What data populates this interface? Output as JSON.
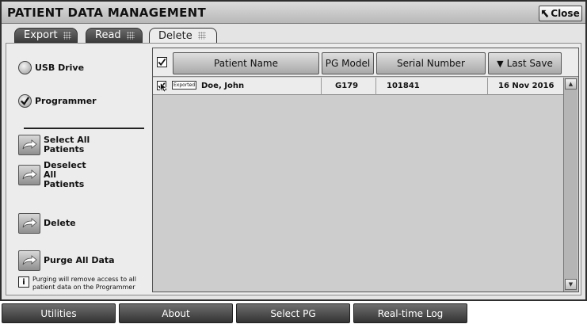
{
  "window": {
    "title": "PATIENT DATA MANAGEMENT",
    "close_label": "Close"
  },
  "tabs": [
    {
      "label": "Export",
      "active": false
    },
    {
      "label": "Read",
      "active": false
    },
    {
      "label": "Delete",
      "active": true
    }
  ],
  "source": {
    "options": [
      {
        "label": "USB Drive",
        "selected": false
      },
      {
        "label": "Programmer",
        "selected": true
      }
    ]
  },
  "actions": {
    "select_all": "Select All Patients",
    "deselect_all": "Deselect All Patients",
    "delete": "Delete",
    "purge_all": "Purge All Data"
  },
  "info": {
    "text": "Purging will remove access to all patient data on the Programmer"
  },
  "table": {
    "columns": [
      "Patient Name",
      "PG Model",
      "Serial Number",
      "Last Save"
    ],
    "sort_column": "Last Save",
    "sort_icon": "sort-descending-icon",
    "rows": [
      {
        "checked": true,
        "badge": "Exported",
        "patient_name": "Doe, John",
        "pg_model": "G179",
        "serial_number": "101841",
        "last_save": "16 Nov 2016"
      }
    ]
  },
  "bottom_nav": [
    "Utilities",
    "About",
    "Select PG",
    "Real-time Log"
  ],
  "colors": {
    "window_bg": "#e4e4e4",
    "table_bg": "#cdcdcd",
    "button_dark": "#333333"
  }
}
